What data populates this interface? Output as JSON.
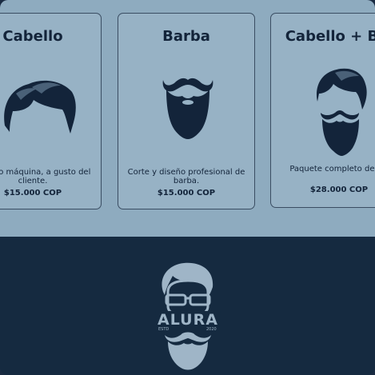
{
  "services": [
    {
      "name": "Cabello",
      "icon": "hair-icon",
      "description": "…era o máquina, a gusto del cliente.",
      "price": "$15.000 COP"
    },
    {
      "name": "Barba",
      "icon": "beard-icon",
      "description": "Corte y diseño profesional de barba.",
      "price": "$15.000 COP"
    },
    {
      "name": "Cabello + Barba",
      "icon": "hair-and-beard-icon",
      "description": "Paquete completo de c… y barba.",
      "price": "$28.000 COP"
    }
  ],
  "footer": {
    "logo_text": "ALURA",
    "logo_left": "ESTD",
    "logo_right": "2020"
  },
  "colors": {
    "section_bg": "#8eabbf",
    "card_bg": "#97b2c5",
    "ink": "#13243a",
    "footer_bg": "#152a40",
    "logo": "#9fb5c7"
  }
}
